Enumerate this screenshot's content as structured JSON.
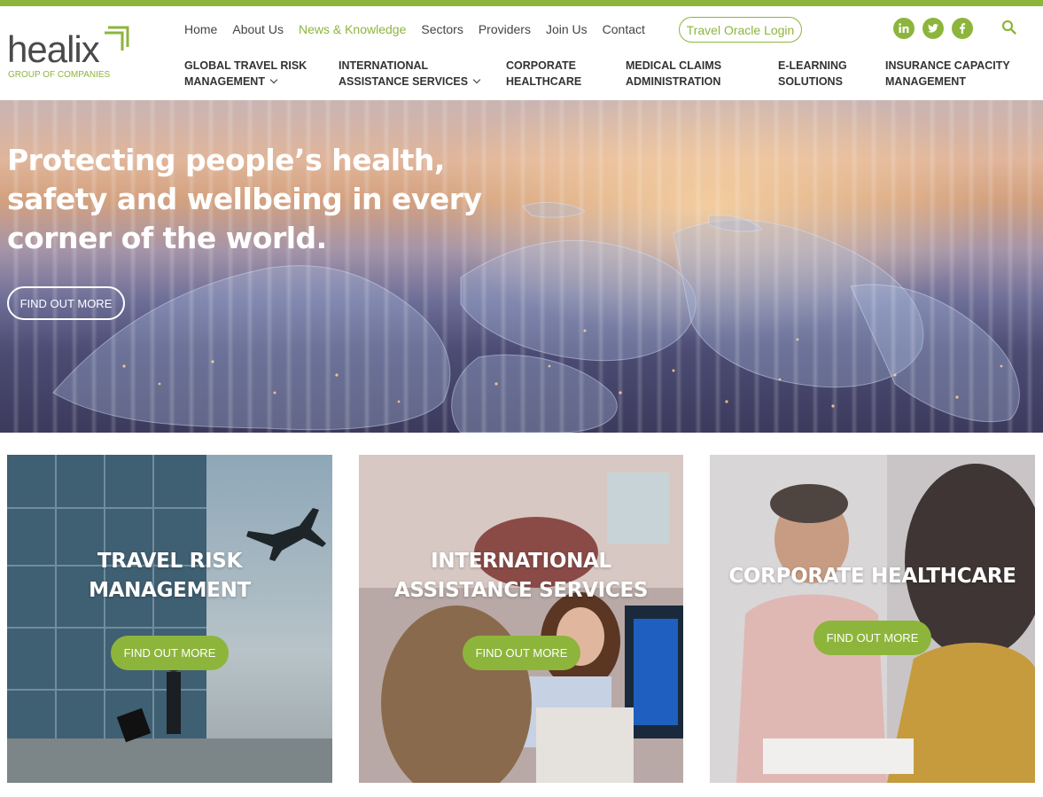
{
  "brand": {
    "logo_word": "healix",
    "logo_sub": "GROUP OF COMPANIES",
    "accent": "#8db53c"
  },
  "topnav": [
    {
      "label": "Home",
      "active": false
    },
    {
      "label": "About Us",
      "active": false
    },
    {
      "label": "News & Knowledge",
      "active": true
    },
    {
      "label": "Sectors",
      "active": false
    },
    {
      "label": "Providers",
      "active": false
    },
    {
      "label": "Join Us",
      "active": false
    },
    {
      "label": "Contact",
      "active": false
    }
  ],
  "login_label": "Travel Oracle Login",
  "socials": [
    "linkedin-icon",
    "twitter-icon",
    "facebook-icon"
  ],
  "mainnav": [
    {
      "line1": "GLOBAL TRAVEL RISK",
      "line2": "MANAGEMENT",
      "dropdown": true
    },
    {
      "line1": "INTERNATIONAL",
      "line2": "ASSISTANCE SERVICES",
      "dropdown": true
    },
    {
      "line1": "CORPORATE",
      "line2": "HEALTHCARE",
      "dropdown": false
    },
    {
      "line1": "MEDICAL CLAIMS",
      "line2": "ADMINISTRATION",
      "dropdown": false
    },
    {
      "line1": "E-LEARNING",
      "line2": "SOLUTIONS",
      "dropdown": false
    },
    {
      "line1": "INSURANCE CAPACITY",
      "line2": "MANAGEMENT",
      "dropdown": false
    }
  ],
  "hero": {
    "title": "Protecting people’s health, safety and wellbeing in every corner of the world.",
    "button": "FIND OUT MORE"
  },
  "cards": [
    {
      "title_line1": "TRAVEL RISK",
      "title_line2": "MANAGEMENT",
      "button": "FIND OUT MORE"
    },
    {
      "title_line1": "INTERNATIONAL",
      "title_line2": "ASSISTANCE SERVICES",
      "button": "FIND OUT MORE"
    },
    {
      "title_line1": "CORPORATE HEALTHCARE",
      "title_line2": "",
      "button": "FIND OUT MORE"
    }
  ]
}
